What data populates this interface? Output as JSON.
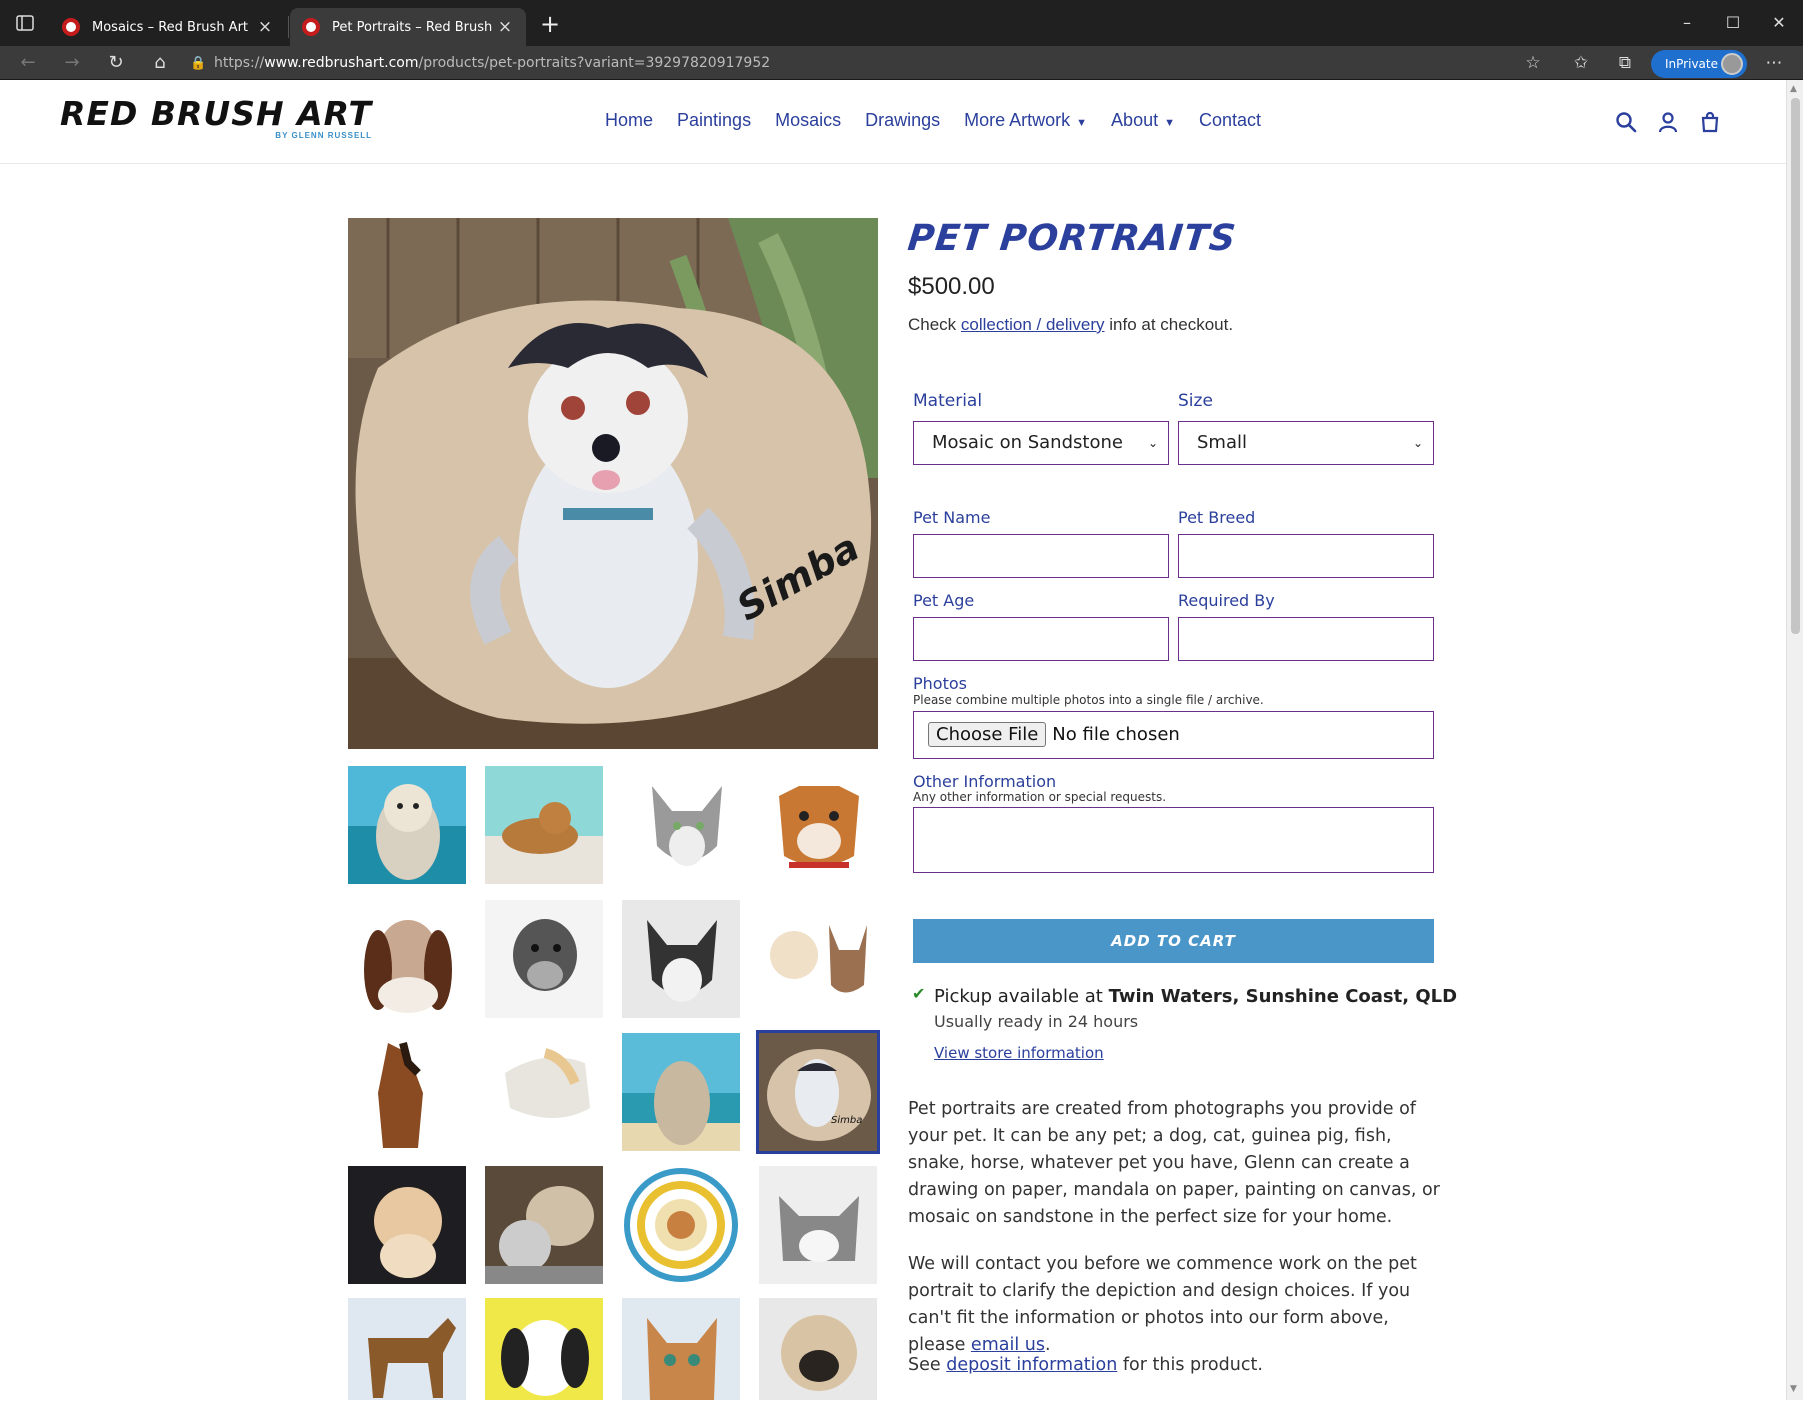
{
  "browser": {
    "tabs": [
      {
        "title": "Mosaics – Red Brush Art",
        "active": false
      },
      {
        "title": "Pet Portraits – Red Brush Art",
        "active": true
      }
    ],
    "url_scheme": "https://",
    "url_host": "www.redbrushart.com",
    "url_path": "/products/pet-portraits?variant=39297820917952",
    "inprivate_label": "InPrivate"
  },
  "site": {
    "logo_main": "RED BRUSH ART",
    "logo_sub": "BY GLENN RUSSELL",
    "nav": [
      {
        "label": "Home",
        "dropdown": false
      },
      {
        "label": "Paintings",
        "dropdown": false
      },
      {
        "label": "Mosaics",
        "dropdown": false
      },
      {
        "label": "Drawings",
        "dropdown": false
      },
      {
        "label": "More Artwork",
        "dropdown": true
      },
      {
        "label": "About",
        "dropdown": true
      },
      {
        "label": "Contact",
        "dropdown": false
      }
    ]
  },
  "product": {
    "title": "PET PORTRAITS",
    "price": "$500.00",
    "checkout_prefix": "Check ",
    "checkout_link": "collection / delivery",
    "checkout_suffix": " info at checkout.",
    "material_label": "Material",
    "material_value": "Mosaic on Sandstone",
    "size_label": "Size",
    "size_value": "Small",
    "pet_name_label": "Pet Name",
    "pet_breed_label": "Pet Breed",
    "pet_age_label": "Pet Age",
    "required_by_label": "Required By",
    "photos_label": "Photos",
    "photos_hint": "Please combine multiple photos into a single file / archive.",
    "file_button": "Choose File",
    "file_status": "No file chosen",
    "other_label": "Other Information",
    "other_hint": "Any other information or special requests.",
    "add_to_cart": "ADD TO CART",
    "pickup_prefix": "Pickup available at ",
    "pickup_location": "Twin Waters, Sunshine Coast, QLD",
    "pickup_ready": "Usually ready in 24 hours",
    "store_link": "View store information",
    "desc1": "Pet portraits are created from photographs you provide of your pet. It can be any pet; a dog, cat, guinea pig, fish, snake, horse, whatever pet you have, Glenn can create a drawing on paper, mandala on paper, painting on canvas, or mosaic on sandstone in the perfect size for your home.",
    "desc2_prefix": "We will contact you before we commence work on the pet portrait to clarify the depiction and design choices. If you can't fit the information or photos into our form above, please ",
    "desc2_link": "email us",
    "desc2_suffix": ".",
    "desc3_prefix": "See ",
    "desc3_link": "deposit information",
    "desc3_suffix": " for this product."
  },
  "colors": {
    "brand_blue": "#2b3f9c",
    "cart_button": "#4a96c8",
    "field_border": "#6a2e8c"
  }
}
